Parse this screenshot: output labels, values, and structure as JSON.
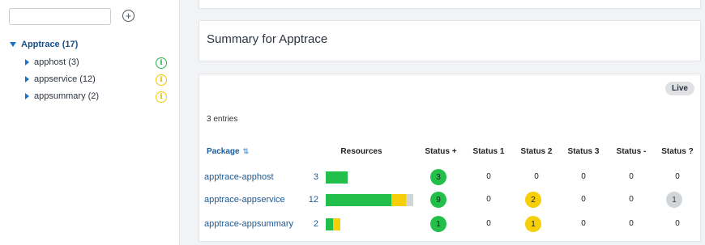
{
  "sidebar": {
    "search": {
      "value": "",
      "placeholder": ""
    },
    "add_symbol": "+",
    "root": {
      "label": "Apptrace (17)"
    },
    "items": [
      {
        "label": "apphost (3)",
        "status": "green"
      },
      {
        "label": "appservice (12)",
        "status": "yellow"
      },
      {
        "label": "appsummary (2)",
        "status": "yellow"
      }
    ],
    "info_symbol": "i"
  },
  "summary": {
    "title": "Summary for Apptrace"
  },
  "table": {
    "live_label": "Live",
    "entries": "3 entries",
    "sort_symbol": "⇅",
    "headers": {
      "package": "Package",
      "resources": "Resources",
      "status_plus": "Status +",
      "status_1": "Status 1",
      "status_2": "Status 2",
      "status_3": "Status 3",
      "status_minus": "Status -",
      "status_q": "Status ?"
    },
    "rows": [
      {
        "package": "apptrace-apphost",
        "resources": "3",
        "bar": [
          {
            "color": "#22c04a",
            "count": 3
          }
        ],
        "status_plus": "3",
        "status_1": "0",
        "status_2": "0",
        "status_3": "0",
        "status_minus": "0",
        "status_q": "0"
      },
      {
        "package": "apptrace-appservice",
        "resources": "12",
        "bar": [
          {
            "color": "#22c04a",
            "count": 9
          },
          {
            "color": "#f5cf0a",
            "count": 2
          },
          {
            "color": "#d2d5d8",
            "count": 1
          }
        ],
        "status_plus": "9",
        "status_1": "0",
        "status_2": "2",
        "status_3": "0",
        "status_minus": "0",
        "status_q": "1"
      },
      {
        "package": "apptrace-appsummary",
        "resources": "2",
        "bar": [
          {
            "color": "#22c04a",
            "count": 1
          },
          {
            "color": "#f5cf0a",
            "count": 1
          }
        ],
        "status_plus": "1",
        "status_1": "0",
        "status_2": "1",
        "status_3": "0",
        "status_minus": "0",
        "status_q": "0"
      }
    ]
  }
}
